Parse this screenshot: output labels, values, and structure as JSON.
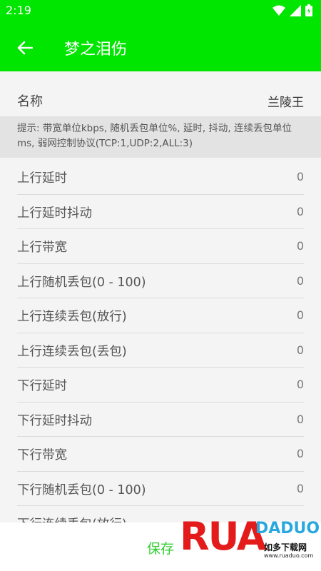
{
  "status_bar": {
    "time": "2:19"
  },
  "app_bar": {
    "title": "梦之泪伤"
  },
  "name_row": {
    "label": "名称",
    "value": "兰陵王"
  },
  "hint": {
    "text": "提示: 带宽单位kbps, 随机丢包单位%, 延时, 抖动, 连续丢包单位ms, 弱网控制协议(TCP:1,UDP:2,ALL:3)"
  },
  "settings": [
    {
      "label": "上行延时",
      "value": "0"
    },
    {
      "label": "上行延时抖动",
      "value": "0"
    },
    {
      "label": "上行带宽",
      "value": "0"
    },
    {
      "label": "上行随机丢包(0 - 100)",
      "value": "0"
    },
    {
      "label": "上行连续丢包(放行)",
      "value": "0"
    },
    {
      "label": "上行连续丢包(丢包)",
      "value": "0"
    },
    {
      "label": "下行延时",
      "value": "0"
    },
    {
      "label": "下行延时抖动",
      "value": "0"
    },
    {
      "label": "下行带宽",
      "value": "0"
    },
    {
      "label": "下行随机丢包(0 - 100)",
      "value": "0"
    },
    {
      "label": "下行连续丢包(放行)",
      "value": ""
    }
  ],
  "bottom_bar": {
    "save_label": "保存"
  },
  "watermark": {
    "brand": "RUAODADUO",
    "cn": "如多下载网",
    "url": "www.ruaduo.com"
  },
  "colors": {
    "primary": "#00e600",
    "save_text": "#33cc33"
  }
}
